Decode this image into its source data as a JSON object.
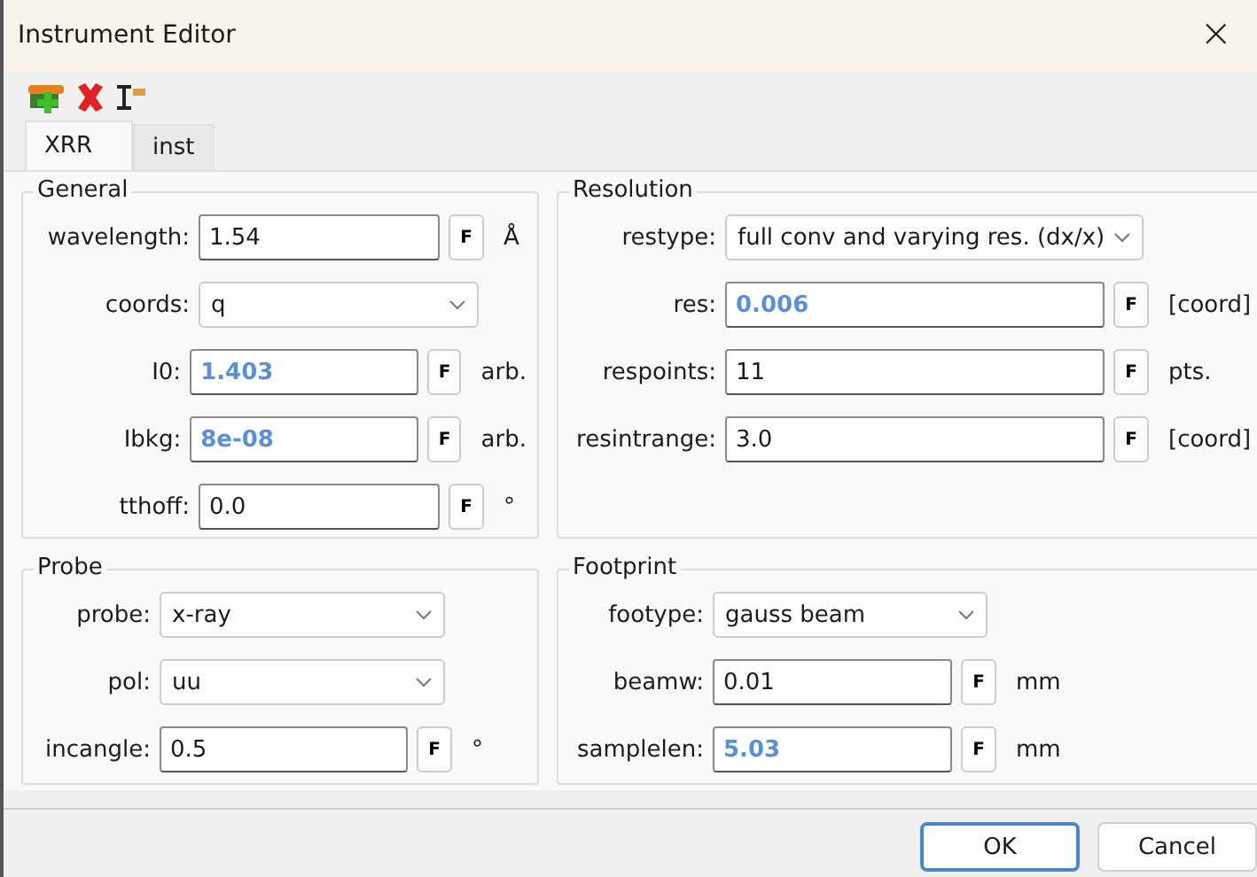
{
  "window": {
    "title": "Instrument Editor",
    "close": "×"
  },
  "tabs": [
    {
      "label": "XRR",
      "selected": true
    },
    {
      "label": "inst",
      "selected": false
    }
  ],
  "groups": [
    {
      "title": "General",
      "rows": [
        {
          "kind": "number",
          "label": "wavelength:",
          "value": "1.54",
          "fitted": false,
          "fit_button": "F",
          "unit": "Å"
        },
        {
          "kind": "choice",
          "label": "coords:",
          "value": "q"
        },
        {
          "kind": "number",
          "label": "I0:",
          "value": "1.403",
          "fitted": true,
          "fit_button": "F",
          "unit": "arb."
        },
        {
          "kind": "number",
          "label": "Ibkg:",
          "value": "8e-08",
          "fitted": true,
          "fit_button": "F",
          "unit": "arb."
        },
        {
          "kind": "number",
          "label": "tthoff:",
          "value": "0.0",
          "fitted": false,
          "fit_button": "F",
          "unit": "°"
        }
      ]
    },
    {
      "title": "Resolution",
      "rows": [
        {
          "kind": "choice",
          "label": "restype:",
          "value": "full conv and varying res. (dx/x)"
        },
        {
          "kind": "number",
          "label": "res:",
          "value": "0.006",
          "fitted": true,
          "fit_button": "F",
          "unit": "[coord]"
        },
        {
          "kind": "number",
          "label": "respoints:",
          "value": "11",
          "fitted": false,
          "fit_button": "F",
          "unit": "pts."
        },
        {
          "kind": "number",
          "label": "resintrange:",
          "value": "3.0",
          "fitted": false,
          "fit_button": "F",
          "unit": "[coord]"
        }
      ]
    },
    {
      "title": "Probe",
      "rows": [
        {
          "kind": "choice",
          "label": "probe:",
          "value": "x-ray"
        },
        {
          "kind": "choice",
          "label": "pol:",
          "value": "uu"
        },
        {
          "kind": "number",
          "label": "incangle:",
          "value": "0.5",
          "fitted": false,
          "fit_button": "F",
          "unit": "°"
        }
      ]
    },
    {
      "title": "Footprint",
      "rows": [
        {
          "kind": "choice",
          "label": "footype:",
          "value": "gauss beam"
        },
        {
          "kind": "number",
          "label": "beamw:",
          "value": "0.01",
          "fitted": false,
          "fit_button": "F",
          "unit": "mm"
        },
        {
          "kind": "number",
          "label": "samplelen:",
          "value": "5.03",
          "fitted": true,
          "fit_button": "F",
          "unit": "mm"
        }
      ]
    }
  ],
  "buttons": [
    {
      "label": "OK",
      "default": true
    },
    {
      "label": "Cancel",
      "default": false
    }
  ]
}
